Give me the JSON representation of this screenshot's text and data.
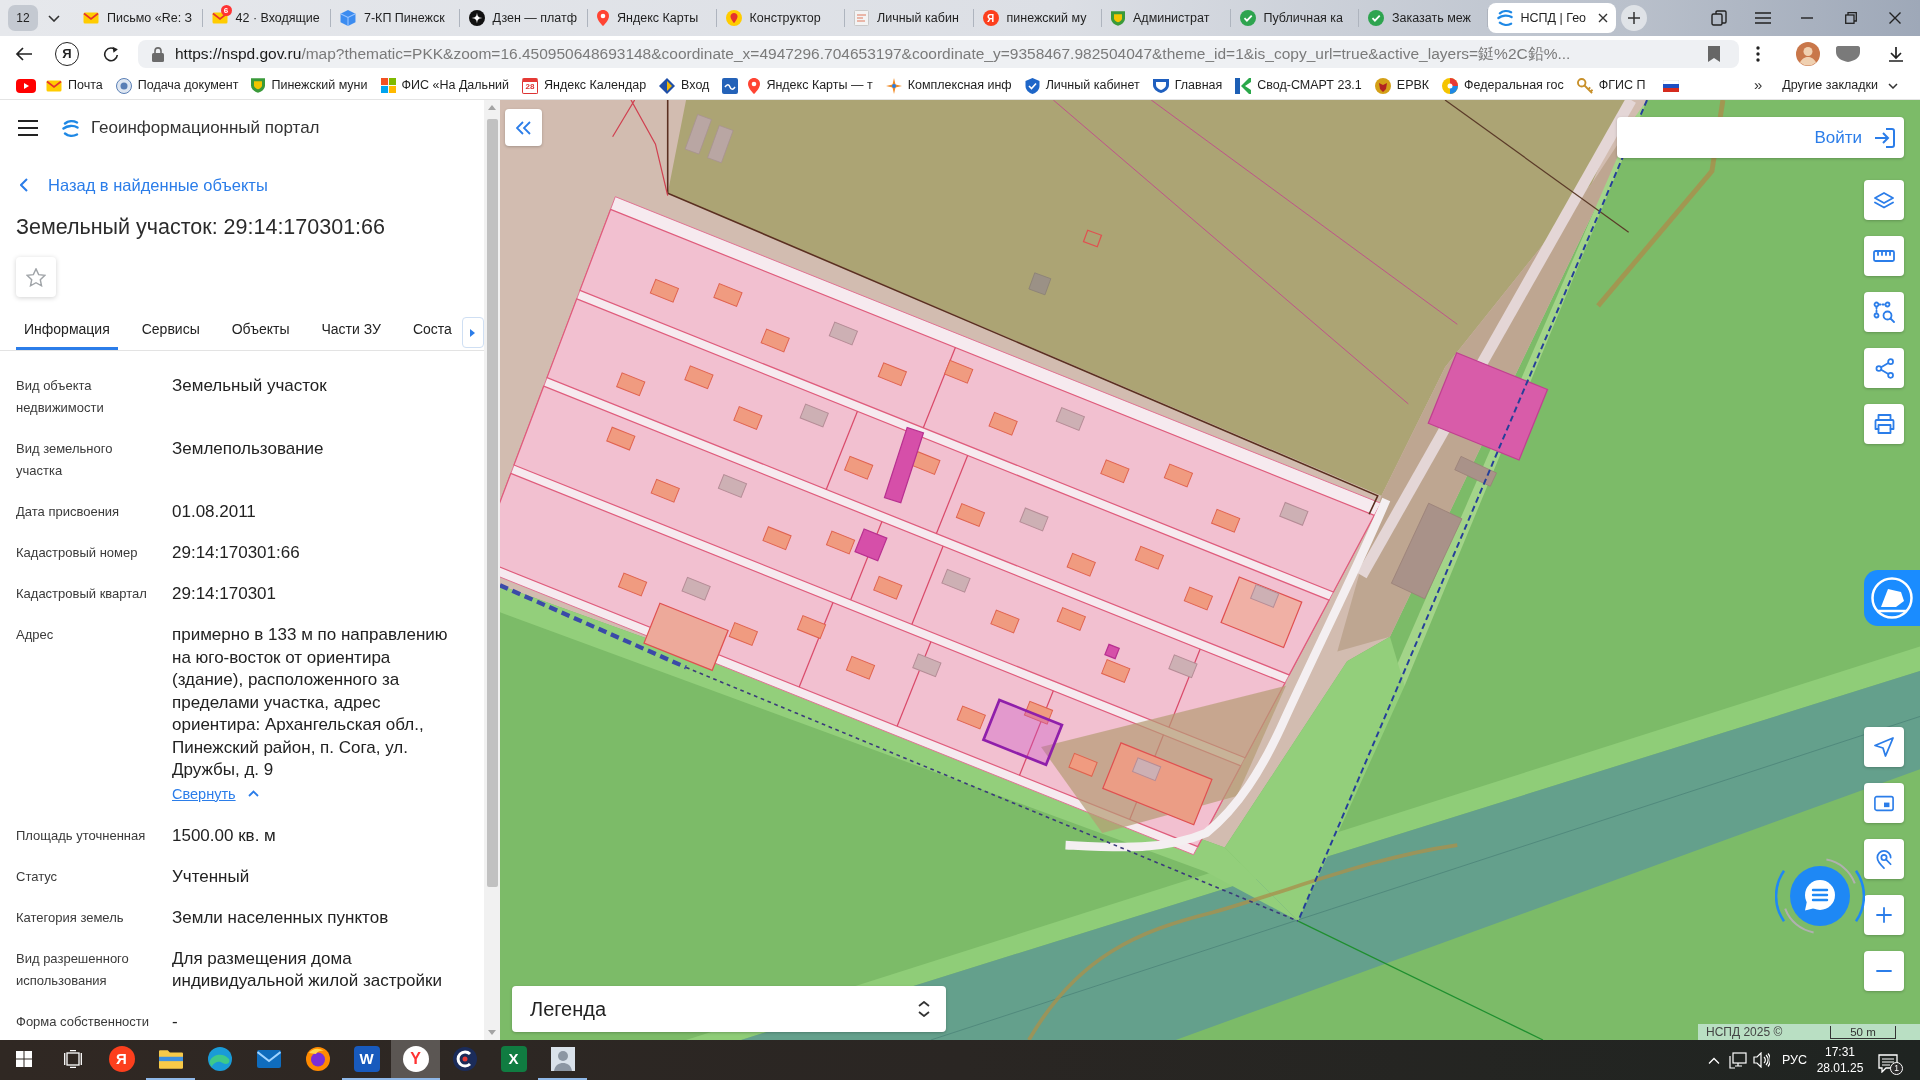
{
  "browser": {
    "tab_counter": "12",
    "tabs": [
      {
        "title": "Письмо «Re: З",
        "selected": false
      },
      {
        "title": "42 · Входящие",
        "badge": "6",
        "selected": false
      },
      {
        "title": "7-КП Пинежск",
        "selected": false
      },
      {
        "title": "Дзен — платф",
        "selected": false
      },
      {
        "title": "Яндекс Карты",
        "selected": false
      },
      {
        "title": "Конструктор",
        "selected": false
      },
      {
        "title": "Личный кабин",
        "selected": false
      },
      {
        "title": "пинежский му",
        "icon_text": "Я",
        "selected": false
      },
      {
        "title": "Администрат",
        "selected": false
      },
      {
        "title": "Публичная ка",
        "selected": false
      },
      {
        "title": "Заказать меж",
        "selected": false
      },
      {
        "title": "НСПД | Гео",
        "selected": true
      }
    ],
    "home_button": "Я",
    "address": {
      "host": "https://nspd.gov.ru",
      "path": "/map?thematic=PKK&zoom=16.450950648693148&coordinate_x=4947296.704653197&coordinate_y=9358467.982504047&theme_id=1&is_copy_url=true&active_layers=鋌%2C鉛%..."
    },
    "bookmarks": [
      {
        "label": "Почта"
      },
      {
        "label": "Подача документ"
      },
      {
        "label": "Пинежский муни"
      },
      {
        "label": "ФИС «На Дальний"
      },
      {
        "label": "Яндекс Календар",
        "icon_text": "28"
      },
      {
        "label": "Вход"
      },
      {
        "label": "Яндекс Карты — т"
      },
      {
        "label": "Комплексная инф"
      },
      {
        "label": "Личный кабинет"
      },
      {
        "label": "Главная"
      },
      {
        "label": "Свод-СМАРТ 23.1"
      },
      {
        "label": "ЕРВК"
      },
      {
        "label": "Федеральная гос"
      },
      {
        "label": "ФГИС П"
      }
    ],
    "bookmarks_overflow": "»",
    "other_bookmarks": "Другие закладки"
  },
  "panel": {
    "title": "Геоинформационный портал",
    "back_link": "Назад в найденные объекты",
    "heading": "Земельный участок: 29:14:170301:66",
    "tabs": [
      {
        "label": "Информация",
        "selected": true
      },
      {
        "label": "Сервисы",
        "selected": false
      },
      {
        "label": "Объекты",
        "selected": false
      },
      {
        "label": "Части ЗУ",
        "selected": false
      },
      {
        "label": "Соста",
        "selected": false
      }
    ],
    "properties": [
      {
        "label": "Вид объекта недвижимости",
        "value": "Земельный участок"
      },
      {
        "label": "Вид земельного участка",
        "value": "Землепользование"
      },
      {
        "label": "Дата присвоения",
        "value": "01.08.2011"
      },
      {
        "label": "Кадастровый номер",
        "value": "29:14:170301:66"
      },
      {
        "label": "Кадастровый квартал",
        "value": "29:14:170301"
      },
      {
        "label": "Адрес",
        "value": "примерно в 133 м по направлению на юго-восток от ориентира (здание), расположенного за пределами участка, адрес ориентира: Архангельская обл., Пинежский район, п. Сога, ул. Дружбы, д. 9",
        "toggle": "Свернуть",
        "expanded": true
      },
      {
        "label": "Площадь уточненная",
        "value": "1500.00 кв. м"
      },
      {
        "label": "Статус",
        "value": "Учтенный"
      },
      {
        "label": "Категория земель",
        "value": "Земли населенных пунктов"
      },
      {
        "label": "Вид разрешенного использования",
        "value": "Для размещения дома индивидуальной жилой застройки"
      },
      {
        "label": "Форма собственности",
        "value": "-"
      }
    ]
  },
  "map": {
    "login": "Войти",
    "legend": "Легенда",
    "attribution": "НСПД 2025 ©",
    "scale": "50 m"
  },
  "taskbar": {
    "apps": [
      {
        "icon_text": "Я",
        "running": false,
        "selected": false
      },
      {
        "running": true,
        "selected": false
      },
      {
        "running": false,
        "selected": false
      },
      {
        "running": false,
        "selected": false
      },
      {
        "running": false,
        "selected": false
      },
      {
        "icon_text": "W",
        "running": true,
        "selected": false
      },
      {
        "icon_text": "Y",
        "running": true,
        "selected": true
      },
      {
        "running": false,
        "selected": false
      },
      {
        "icon_text": "X",
        "running": false,
        "selected": false
      },
      {
        "running": true,
        "selected": false
      }
    ],
    "language": "РУС",
    "time": "17:31",
    "date": "28.01.25",
    "notifications": "1"
  }
}
